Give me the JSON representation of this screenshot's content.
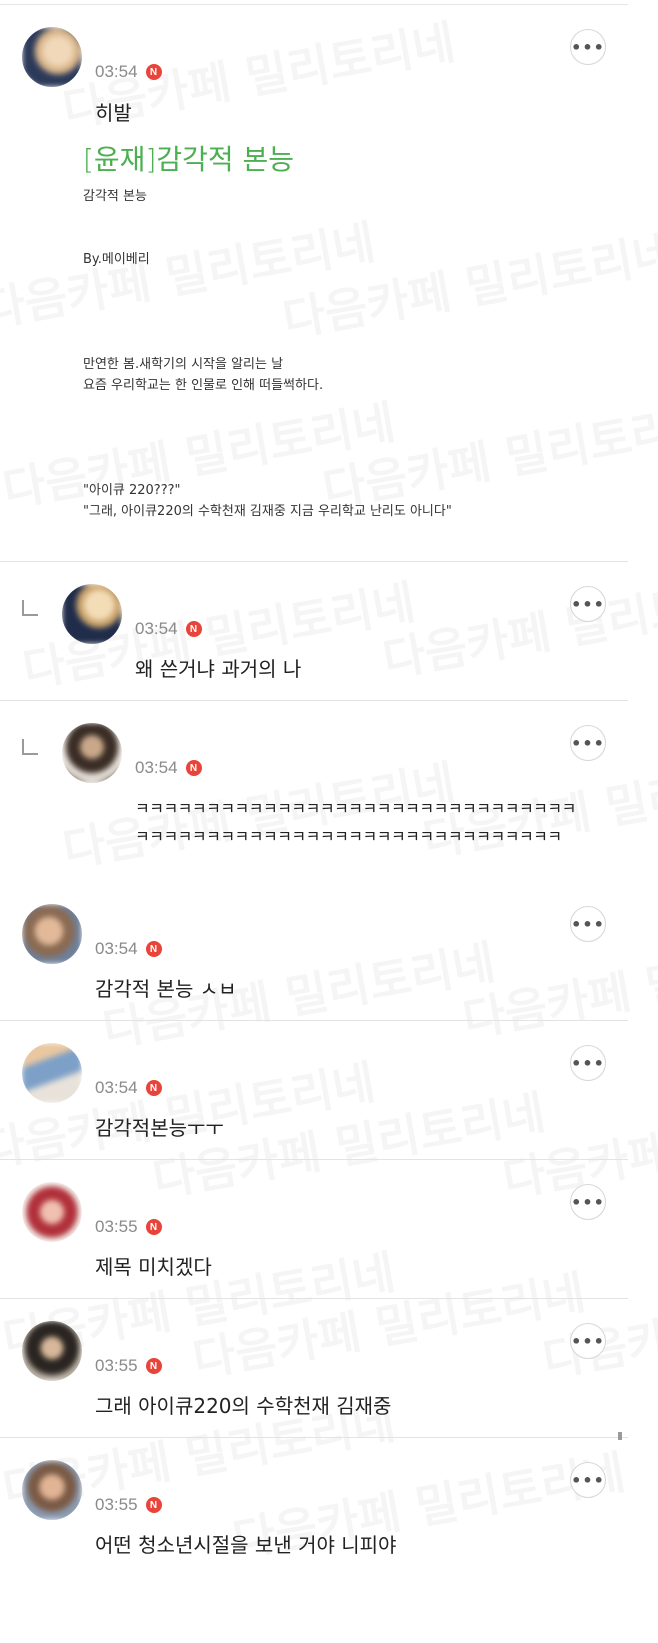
{
  "watermark": "다음카페 밀리토리네",
  "colors": {
    "accent_green": "#4caf50",
    "badge_red": "#e8443a"
  },
  "post": {
    "time": "03:54",
    "badge": "N",
    "author_line": "히발",
    "title": "[윤재]감각적 본능",
    "subtitle": "감각적 본능",
    "byline": "By.메이베리",
    "para1_line1": "만연한 봄.새학기의 시작을 알리는 날",
    "para1_line2": "요즘 우리학교는 한 인물로 인해 떠들썩하다.",
    "quote1": "\"아이큐 220???\"",
    "quote2": "\"그래, 아이큐220의 수학천재 김재중 지금 우리학교 난리도 아니다\""
  },
  "more_label": "•••",
  "comments": [
    {
      "time": "03:54",
      "badge": "N",
      "text": "왜 쓴거냐 과거의 나"
    },
    {
      "time": "03:54",
      "badge": "N",
      "line1": "ㅋㅋㅋㅋㅋㅋㅋㅋㅋㅋㅋㅋㅋㅋㅋㅋㅋㅋㅋㅋㅋㅋㅋㅋㅋㅋㅋㅋㅋㅋㅋ",
      "line2": "ㅋㅋㅋㅋㅋㅋㅋㅋㅋㅋㅋㅋㅋㅋㅋㅋㅋㅋㅋㅋㅋㅋㅋㅋㅋㅋㅋㅋㅋㅋ"
    },
    {
      "time": "03:54",
      "badge": "N",
      "text": "감각적 본능 ㅅㅂ"
    },
    {
      "time": "03:54",
      "badge": "N",
      "text": "감각적본능ㅜㅜ"
    },
    {
      "time": "03:55",
      "badge": "N",
      "text": "제목 미치겠다"
    },
    {
      "time": "03:55",
      "badge": "N",
      "text": "그래 아이큐220의 수학천재 김재중"
    },
    {
      "time": "03:55",
      "badge": "N",
      "text": "어떤 청소년시절을 보낸 거야 니피야"
    }
  ]
}
